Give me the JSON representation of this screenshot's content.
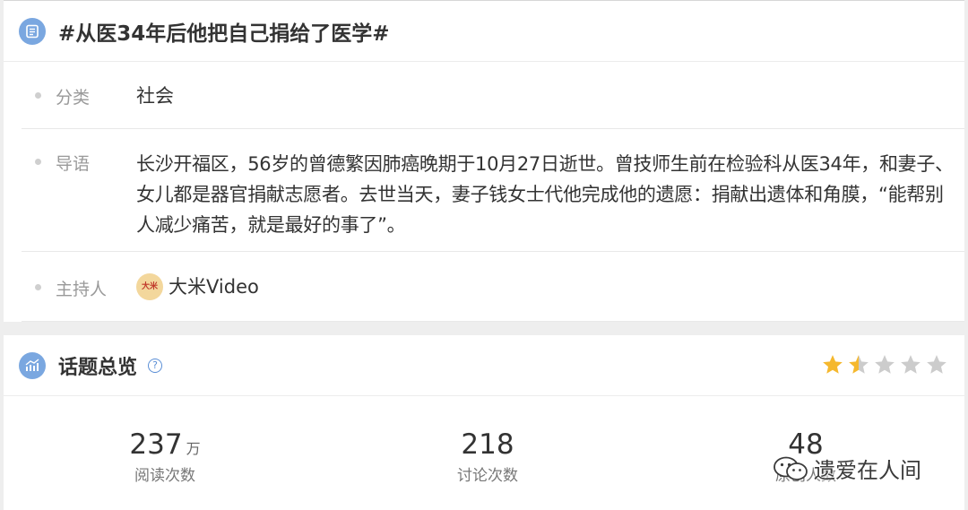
{
  "topic": {
    "title": "#从医34年后他把自己捐给了医学#",
    "rows": {
      "category": {
        "label": "分类",
        "value": "社会"
      },
      "intro": {
        "label": "导语",
        "value": "长沙开福区，56岁的曾德繁因肺癌晚期于10月27日逝世。曾技师生前在检验科从医34年，和妻子、女儿都是器官捐献志愿者。去世当天，妻子钱女士代他完成他的遗愿：捐献出遗体和角膜，“能帮别人减少痛苦，就是最好的事了”。"
      },
      "host": {
        "label": "主持人",
        "value": "大米Video",
        "avatar_text": "大米"
      }
    }
  },
  "overview": {
    "title": "话题总览",
    "help_glyph": "?",
    "rating": {
      "value": 1.5,
      "max": 5,
      "filled_color": "#f5b82e",
      "empty_color": "#cccccc"
    },
    "stats": [
      {
        "value": "237",
        "unit": "万",
        "label": "阅读次数"
      },
      {
        "value": "218",
        "unit": "",
        "label": "讨论次数"
      },
      {
        "value": "48",
        "unit": "",
        "label": "原创人数"
      }
    ]
  },
  "watermark": {
    "text": "遗爱在人间",
    "icon": "wechat-icon"
  },
  "colors": {
    "accent": "#7aa7e0",
    "link_blue": "#5b8fd6"
  }
}
